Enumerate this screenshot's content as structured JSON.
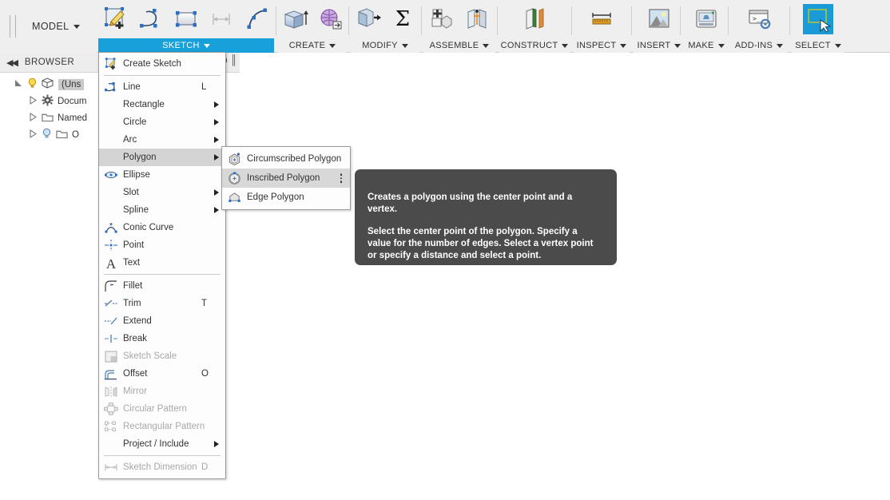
{
  "toolbar": {
    "workspace_label": "MODEL",
    "panels": [
      {
        "id": "sketch",
        "label": "SKETCH",
        "active": true,
        "icons": [
          "create-sketch-icon",
          "line-icon",
          "rectangle-icon",
          "dimension-icon",
          "arc-icon"
        ]
      },
      {
        "id": "create",
        "label": "CREATE",
        "active": false,
        "icons": [
          "extrude-icon",
          "mesh-icon"
        ]
      },
      {
        "id": "modify",
        "label": "MODIFY",
        "active": false,
        "icons": [
          "press-pull-icon",
          "sigma-icon"
        ]
      },
      {
        "id": "assemble",
        "label": "ASSEMBLE",
        "active": false,
        "icons": [
          "new-component-icon",
          "joint-icon"
        ]
      },
      {
        "id": "construct",
        "label": "CONSTRUCT",
        "active": false,
        "icons": [
          "offset-plane-icon"
        ]
      },
      {
        "id": "inspect",
        "label": "INSPECT",
        "active": false,
        "icons": [
          "measure-icon"
        ]
      },
      {
        "id": "insert",
        "label": "INSERT",
        "active": false,
        "icons": [
          "insert-image-icon"
        ]
      },
      {
        "id": "make",
        "label": "MAKE",
        "active": false,
        "icons": [
          "3d-print-icon"
        ]
      },
      {
        "id": "addins",
        "label": "ADD-INS",
        "active": false,
        "icons": [
          "scripts-addins-icon"
        ]
      },
      {
        "id": "select",
        "label": "SELECT",
        "active": false,
        "icons": [
          "select-cursor-icon"
        ]
      }
    ]
  },
  "browser": {
    "title": "BROWSER",
    "collapse_icon": "collapse-left-icon",
    "header_icons": [
      "minus-circle-icon",
      "panel-bars-icon"
    ],
    "tree": [
      {
        "label": "(Uns",
        "indent": 0,
        "expanded": true,
        "bulb": true,
        "icon": "component-icon",
        "selected": true
      },
      {
        "label": "Docum",
        "indent": 1,
        "expanded": false,
        "bulb": false,
        "icon": "gear-icon",
        "selected": false
      },
      {
        "label": "Named",
        "indent": 1,
        "expanded": false,
        "bulb": false,
        "icon": "folder-icon",
        "selected": false
      },
      {
        "label": "O",
        "indent": 1,
        "expanded": false,
        "bulb": true,
        "icon": "folder-icon",
        "selected": false
      }
    ]
  },
  "sketch_menu": {
    "items": [
      {
        "label": "Create Sketch",
        "icon": "create-sketch-icon",
        "key": "",
        "arrow": false,
        "disabled": false,
        "highlighted": false,
        "separator_after": true
      },
      {
        "label": "Line",
        "icon": "line-icon",
        "key": "L",
        "arrow": false,
        "disabled": false,
        "highlighted": false,
        "separator_after": false
      },
      {
        "label": "Rectangle",
        "icon": "",
        "key": "",
        "arrow": true,
        "disabled": false,
        "highlighted": false,
        "separator_after": false
      },
      {
        "label": "Circle",
        "icon": "",
        "key": "",
        "arrow": true,
        "disabled": false,
        "highlighted": false,
        "separator_after": false
      },
      {
        "label": "Arc",
        "icon": "",
        "key": "",
        "arrow": true,
        "disabled": false,
        "highlighted": false,
        "separator_after": false
      },
      {
        "label": "Polygon",
        "icon": "",
        "key": "",
        "arrow": true,
        "disabled": false,
        "highlighted": true,
        "separator_after": false
      },
      {
        "label": "Ellipse",
        "icon": "ellipse-icon",
        "key": "",
        "arrow": false,
        "disabled": false,
        "highlighted": false,
        "separator_after": false
      },
      {
        "label": "Slot",
        "icon": "",
        "key": "",
        "arrow": true,
        "disabled": false,
        "highlighted": false,
        "separator_after": false
      },
      {
        "label": "Spline",
        "icon": "",
        "key": "",
        "arrow": true,
        "disabled": false,
        "highlighted": false,
        "separator_after": false
      },
      {
        "label": "Conic Curve",
        "icon": "conic-curve-icon",
        "key": "",
        "arrow": false,
        "disabled": false,
        "highlighted": false,
        "separator_after": false
      },
      {
        "label": "Point",
        "icon": "point-icon",
        "key": "",
        "arrow": false,
        "disabled": false,
        "highlighted": false,
        "separator_after": false
      },
      {
        "label": "Text",
        "icon": "text-icon",
        "key": "",
        "arrow": false,
        "disabled": false,
        "highlighted": false,
        "separator_after": true
      },
      {
        "label": "Fillet",
        "icon": "fillet-icon",
        "key": "",
        "arrow": false,
        "disabled": false,
        "highlighted": false,
        "separator_after": false
      },
      {
        "label": "Trim",
        "icon": "trim-icon",
        "key": "T",
        "arrow": false,
        "disabled": false,
        "highlighted": false,
        "separator_after": false
      },
      {
        "label": "Extend",
        "icon": "extend-icon",
        "key": "",
        "arrow": false,
        "disabled": false,
        "highlighted": false,
        "separator_after": false
      },
      {
        "label": "Break",
        "icon": "break-icon",
        "key": "",
        "arrow": false,
        "disabled": false,
        "highlighted": false,
        "separator_after": false
      },
      {
        "label": "Sketch Scale",
        "icon": "sketch-scale-icon",
        "key": "",
        "arrow": false,
        "disabled": true,
        "highlighted": false,
        "separator_after": false
      },
      {
        "label": "Offset",
        "icon": "offset-icon",
        "key": "O",
        "arrow": false,
        "disabled": false,
        "highlighted": false,
        "separator_after": false
      },
      {
        "label": "Mirror",
        "icon": "mirror-icon",
        "key": "",
        "arrow": false,
        "disabled": true,
        "highlighted": false,
        "separator_after": false
      },
      {
        "label": "Circular Pattern",
        "icon": "circular-pattern-icon",
        "key": "",
        "arrow": false,
        "disabled": true,
        "highlighted": false,
        "separator_after": false
      },
      {
        "label": "Rectangular Pattern",
        "icon": "rectangular-pattern-icon",
        "key": "",
        "arrow": false,
        "disabled": true,
        "highlighted": false,
        "separator_after": false
      },
      {
        "label": "Project / Include",
        "icon": "",
        "key": "",
        "arrow": true,
        "disabled": false,
        "highlighted": false,
        "separator_after": true
      },
      {
        "label": "Sketch Dimension",
        "icon": "sketch-dimension-icon",
        "key": "D",
        "arrow": false,
        "disabled": true,
        "highlighted": false,
        "separator_after": false
      }
    ]
  },
  "polygon_submenu": {
    "items": [
      {
        "label": "Circumscribed Polygon",
        "icon": "circumscribed-polygon-icon",
        "highlighted": false,
        "kebab": false
      },
      {
        "label": "Inscribed Polygon",
        "icon": "inscribed-polygon-icon",
        "highlighted": true,
        "kebab": true
      },
      {
        "label": "Edge Polygon",
        "icon": "edge-polygon-icon",
        "highlighted": false,
        "kebab": false
      }
    ]
  },
  "tooltip": {
    "paragraph1": "Creates a polygon using the center point and a vertex.",
    "paragraph2": "Select the center point of the polygon. Specify a value for the number of edges. Select a vertex point or specify a distance and select a point."
  },
  "colors": {
    "accent_blue": "#18a0db",
    "select_tile": "#1b9ad8",
    "toolbar_bg": "#efefef",
    "menu_bg": "#fdfdfd",
    "menu_highlight": "#d4d4d4",
    "tooltip_bg": "#4b4b4b",
    "disabled_text": "#a8a8a8"
  }
}
